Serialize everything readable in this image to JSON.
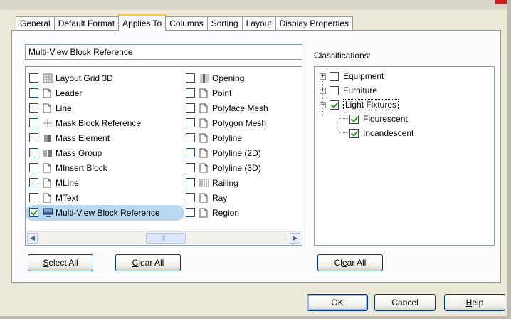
{
  "tabs": [
    {
      "label": "General",
      "active": false
    },
    {
      "label": "Default Format",
      "active": false
    },
    {
      "label": "Applies To",
      "active": true
    },
    {
      "label": "Columns",
      "active": false
    },
    {
      "label": "Sorting",
      "active": false
    },
    {
      "label": "Layout",
      "active": false
    },
    {
      "label": "Display Properties",
      "active": false
    }
  ],
  "name_field": {
    "value": "Multi-View Block Reference"
  },
  "objects": {
    "column1": [
      {
        "label": "Layout Grid 3D",
        "checked": false,
        "icon": "layout-grid-icon"
      },
      {
        "label": "Leader",
        "checked": false,
        "icon": "document-icon"
      },
      {
        "label": "Line",
        "checked": false,
        "icon": "document-icon"
      },
      {
        "label": "Mask Block Reference",
        "checked": false,
        "icon": "mask-block-icon"
      },
      {
        "label": "Mass Element",
        "checked": false,
        "icon": "mass-element-icon"
      },
      {
        "label": "Mass Group",
        "checked": false,
        "icon": "mass-group-icon"
      },
      {
        "label": "MInsert Block",
        "checked": false,
        "icon": "document-icon"
      },
      {
        "label": "MLine",
        "checked": false,
        "icon": "document-icon"
      },
      {
        "label": "MText",
        "checked": false,
        "icon": "document-icon"
      },
      {
        "label": "Multi-View Block Reference",
        "checked": true,
        "icon": "multi-view-block-icon"
      }
    ],
    "column2": [
      {
        "label": "Opening",
        "checked": false,
        "icon": "opening-icon"
      },
      {
        "label": "Point",
        "checked": false,
        "icon": "document-icon"
      },
      {
        "label": "Polyface Mesh",
        "checked": false,
        "icon": "document-icon"
      },
      {
        "label": "Polygon Mesh",
        "checked": false,
        "icon": "document-icon"
      },
      {
        "label": "Polyline",
        "checked": false,
        "icon": "document-icon"
      },
      {
        "label": "Polyline (2D)",
        "checked": false,
        "icon": "document-icon"
      },
      {
        "label": "Polyline (3D)",
        "checked": false,
        "icon": "document-icon"
      },
      {
        "label": "Railing",
        "checked": false,
        "icon": "railing-icon"
      },
      {
        "label": "Ray",
        "checked": false,
        "icon": "document-icon"
      },
      {
        "label": "Region",
        "checked": false,
        "icon": "document-icon"
      }
    ]
  },
  "classifications": {
    "label": "Classifications:",
    "tree": [
      {
        "label": "Equipment",
        "checked": false,
        "expander": "+"
      },
      {
        "label": "Furniture",
        "checked": false,
        "expander": "+"
      },
      {
        "label": "Light Fixtures",
        "checked": true,
        "expander": "−",
        "selected": true,
        "children": [
          {
            "label": "Flourescent",
            "checked": true
          },
          {
            "label": "Incandescent",
            "checked": true
          }
        ]
      }
    ]
  },
  "buttons": {
    "select_all": {
      "prefix": "",
      "mnemonic": "S",
      "rest": "elect All"
    },
    "clear_all_left": {
      "prefix": "",
      "mnemonic": "C",
      "rest": "lear All"
    },
    "clear_all_right": {
      "prefix": "Cl",
      "mnemonic": "e",
      "rest": "ar All"
    },
    "ok": {
      "label": "OK"
    },
    "cancel": {
      "label": "Cancel"
    },
    "help": {
      "prefix": "",
      "mnemonic": "H",
      "rest": "elp"
    }
  },
  "colors": {
    "dialog_bg": "#ece9d8",
    "highlight": "#b9d7ee",
    "tab_active_accent": "#ffc83c",
    "check_mark": "#21a121",
    "window_close_red": "#c8201c"
  }
}
